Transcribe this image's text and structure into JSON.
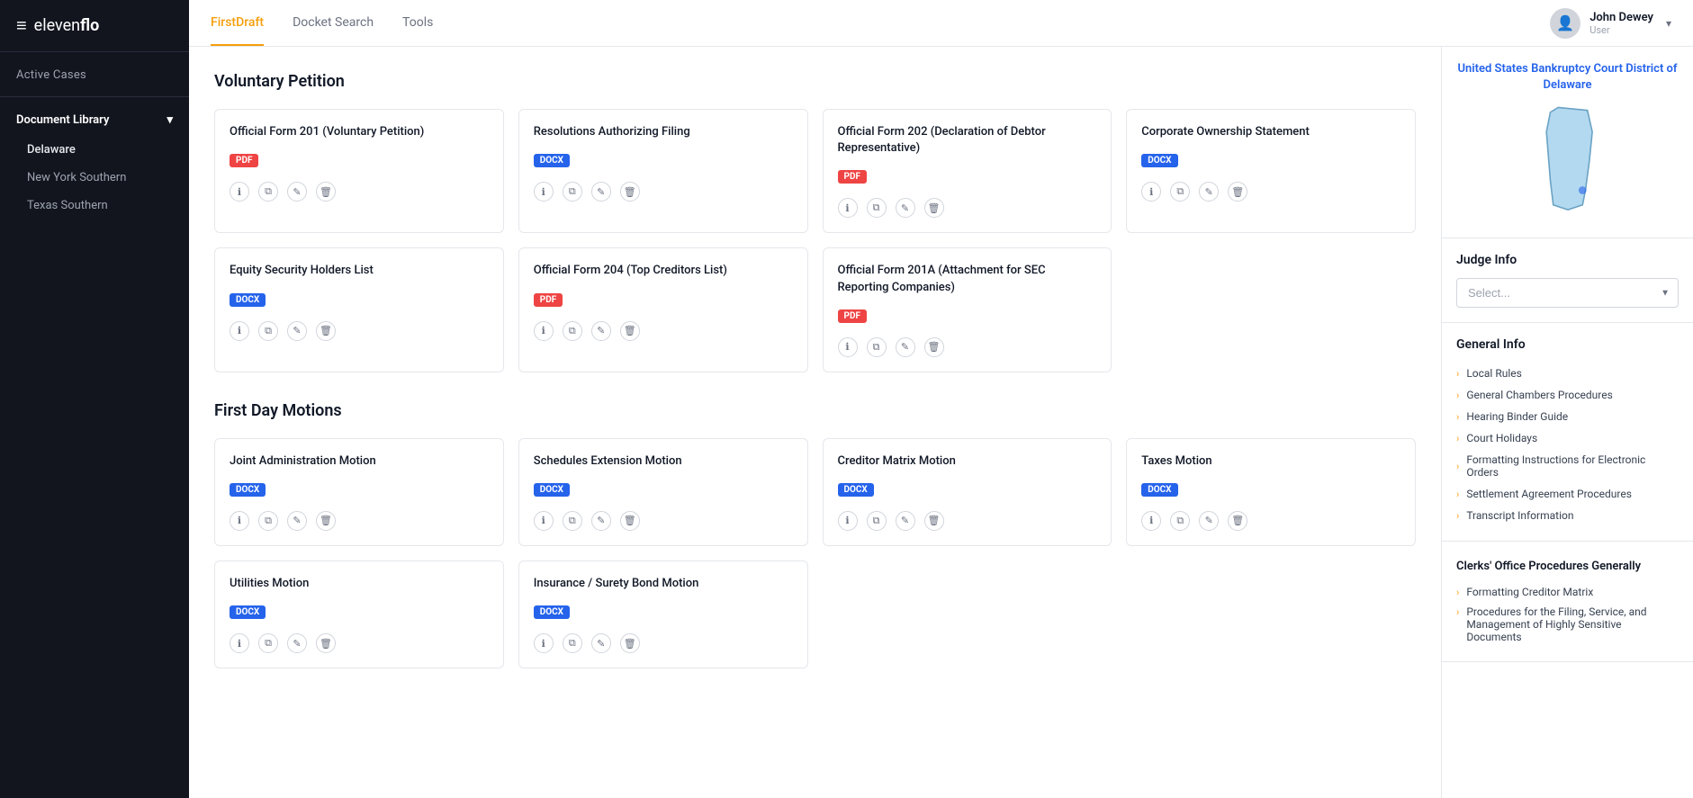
{
  "logo": {
    "icon": "≡",
    "text_part1": "eleven",
    "text_part2": "flo"
  },
  "sidebar": {
    "active_cases_label": "Active Cases",
    "document_library_label": "Document Library",
    "courts": [
      {
        "name": "Delaware",
        "active": true
      },
      {
        "name": "New York Southern",
        "active": false
      },
      {
        "name": "Texas Southern",
        "active": false
      }
    ]
  },
  "nav": {
    "tabs": [
      {
        "label": "FirstDraft",
        "active": true
      },
      {
        "label": "Docket Search",
        "active": false
      },
      {
        "label": "Tools",
        "active": false
      }
    ],
    "user": {
      "name": "John Dewey",
      "role": "User"
    }
  },
  "voluntary_petition": {
    "section_title": "Voluntary Petition",
    "cards": [
      {
        "title": "Official Form 201 (Voluntary Petition)",
        "badge": "PDF",
        "badge_type": "pdf"
      },
      {
        "title": "Resolutions Authorizing Filing",
        "badge": "DOCX",
        "badge_type": "docx"
      },
      {
        "title": "Official Form 202 (Declaration of Debtor Representative)",
        "badge": "PDF",
        "badge_type": "pdf"
      },
      {
        "title": "Corporate Ownership Statement",
        "badge": "DOCX",
        "badge_type": "docx"
      },
      {
        "title": "Equity Security Holders List",
        "badge": "DOCX",
        "badge_type": "docx"
      },
      {
        "title": "Official Form 204 (Top Creditors List)",
        "badge": "PDF",
        "badge_type": "pdf"
      },
      {
        "title": "Official Form 201A (Attachment for SEC Reporting Companies)",
        "badge": "PDF",
        "badge_type": "pdf"
      }
    ]
  },
  "first_day_motions": {
    "section_title": "First Day Motions",
    "cards": [
      {
        "title": "Joint Administration Motion",
        "badge": "DOCX",
        "badge_type": "docx"
      },
      {
        "title": "Schedules Extension Motion",
        "badge": "DOCX",
        "badge_type": "docx"
      },
      {
        "title": "Creditor Matrix Motion",
        "badge": "DOCX",
        "badge_type": "docx"
      },
      {
        "title": "Taxes Motion",
        "badge": "DOCX",
        "badge_type": "docx"
      },
      {
        "title": "Utilities Motion",
        "badge": "DOCX",
        "badge_type": "docx"
      },
      {
        "title": "Insurance / Surety Bond Motion",
        "badge": "DOCX",
        "badge_type": "docx"
      }
    ]
  },
  "right_panel": {
    "court_title": "United States Bankruptcy Court District of Delaware",
    "judge_info_label": "Judge Info",
    "judge_select_placeholder": "Select...",
    "general_info_label": "General Info",
    "general_info_links": [
      "Local Rules",
      "General Chambers Procedures",
      "Hearing Binder Guide",
      "Court Holidays",
      "Formatting Instructions for Electronic Orders",
      "Settlement Agreement Procedures",
      "Transcript Information"
    ],
    "clerks_office_label": "Clerks' Office Procedures Generally",
    "clerks_office_links": [
      {
        "text": "Formatting Creditor Matrix",
        "multiline": false
      },
      {
        "text": "Procedures for the Filing, Service, and Management of Highly Sensitive Documents",
        "multiline": true
      }
    ]
  },
  "icons": {
    "info": "ℹ",
    "copy": "⧉",
    "edit": "✎",
    "trash": "🗑",
    "chevron_right": "›",
    "chevron_down": "▾",
    "user": "👤"
  }
}
